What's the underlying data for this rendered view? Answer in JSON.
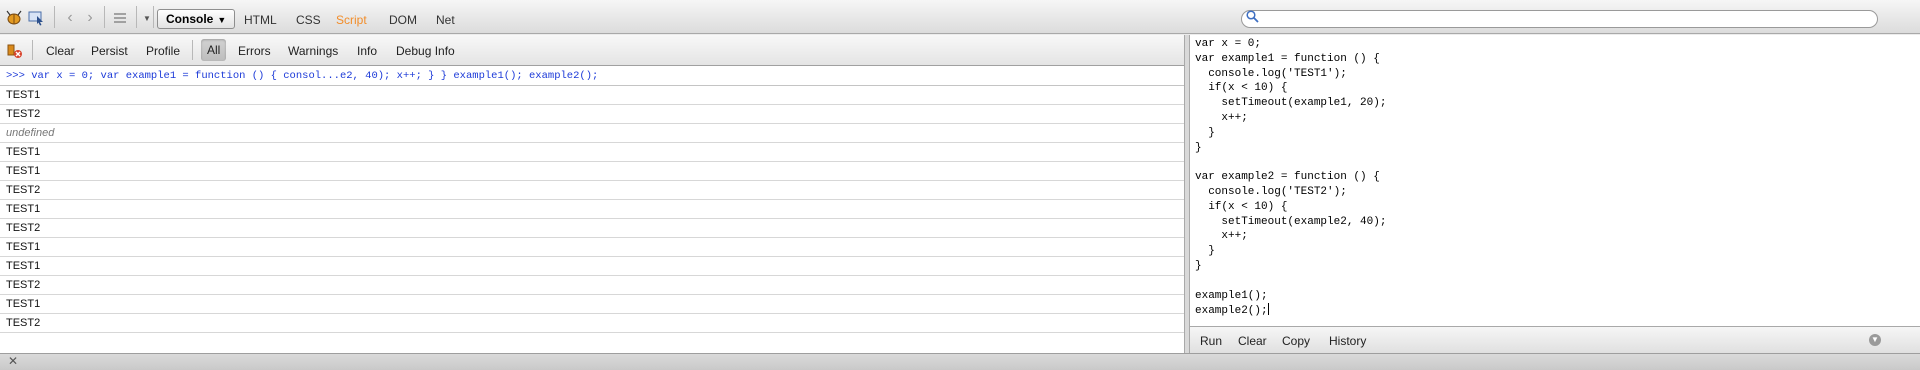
{
  "toolbar": {
    "console_label": "Console",
    "tabs": [
      "HTML",
      "CSS",
      "Script",
      "DOM",
      "Net"
    ],
    "search_placeholder": ""
  },
  "console_toolbar": {
    "buttons": [
      "Clear",
      "Persist",
      "Profile",
      "All",
      "Errors",
      "Warnings",
      "Info",
      "Debug Info"
    ]
  },
  "log": [
    ">>> var x = 0; var example1 = function () {   consol...e2, 40);     x++;   } }  example1(); example2();",
    "TEST1",
    "TEST2",
    "undefined",
    "TEST1",
    "TEST1",
    "TEST2",
    "TEST1",
    "TEST2",
    "TEST1",
    "TEST1",
    "TEST2",
    "TEST1",
    "TEST2"
  ],
  "editor": {
    "code": "var x = 0;\nvar example1 = function () {\n  console.log('TEST1');\n  if(x < 10) {\n    setTimeout(example1, 20);\n    x++;\n  }\n}\n\nvar example2 = function () {\n  console.log('TEST2');\n  if(x < 10) {\n    setTimeout(example2, 40);\n    x++;\n  }\n}\n\nexample1();\nexample2();"
  },
  "command_bar": {
    "buttons": [
      "Run",
      "Clear",
      "Copy",
      "History"
    ]
  },
  "colors": {
    "script_tab": "#f28d2a",
    "command_text": "#1c3ad8"
  }
}
